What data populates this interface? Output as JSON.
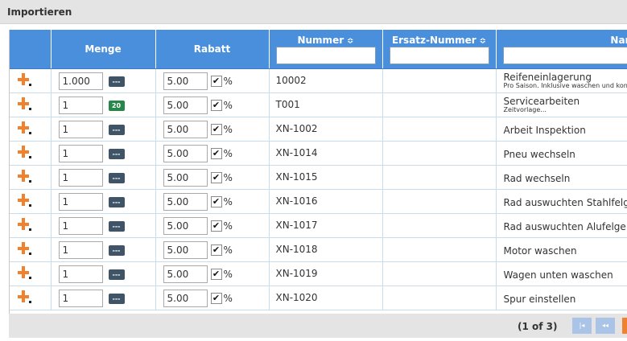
{
  "panel": {
    "title": "Importieren"
  },
  "columns": {
    "menge": "Menge",
    "rabatt": "Rabatt",
    "nummer": "Nummer",
    "ersatz": "Ersatz-Nummer",
    "name": "Name",
    "sort_glyph": "≎"
  },
  "icons": {
    "add": "add-plus-icon",
    "sort": "sort-icon",
    "check": "✔",
    "percent": "%"
  },
  "colors": {
    "header": "#4a8fdc",
    "accent": "#f0822d",
    "unit_button": "#405468",
    "badge_green": "#27874a"
  },
  "rows": [
    {
      "menge": "1.000",
      "unit": "---",
      "rabatt": "5.00",
      "nummer": "10002",
      "name": "Reifeneinlagerung",
      "desc": "Pro Saison. Inklusive waschen und kontr"
    },
    {
      "menge": "1",
      "unit": "20",
      "rabatt": "5.00",
      "nummer": "T001",
      "name": "Servicearbeiten",
      "desc": "Zeitvorlage..."
    },
    {
      "menge": "1",
      "unit": "---",
      "rabatt": "5.00",
      "nummer": "XN-1002",
      "name": "Arbeit Inspektion",
      "desc": ""
    },
    {
      "menge": "1",
      "unit": "---",
      "rabatt": "5.00",
      "nummer": "XN-1014",
      "name": "Pneu wechseln",
      "desc": ""
    },
    {
      "menge": "1",
      "unit": "---",
      "rabatt": "5.00",
      "nummer": "XN-1015",
      "name": "Rad wechseln",
      "desc": ""
    },
    {
      "menge": "1",
      "unit": "---",
      "rabatt": "5.00",
      "nummer": "XN-1016",
      "name": "Rad auswuchten Stahlfelge",
      "desc": ""
    },
    {
      "menge": "1",
      "unit": "---",
      "rabatt": "5.00",
      "nummer": "XN-1017",
      "name": "Rad auswuchten Alufelge",
      "desc": ""
    },
    {
      "menge": "1",
      "unit": "---",
      "rabatt": "5.00",
      "nummer": "XN-1018",
      "name": "Motor waschen",
      "desc": ""
    },
    {
      "menge": "1",
      "unit": "---",
      "rabatt": "5.00",
      "nummer": "XN-1019",
      "name": "Wagen unten waschen",
      "desc": ""
    },
    {
      "menge": "1",
      "unit": "---",
      "rabatt": "5.00",
      "nummer": "XN-1020",
      "name": "Spur einstellen",
      "desc": ""
    }
  ],
  "pager": {
    "info": "(1 of 3)",
    "first": "|◂",
    "prev": "◂◂"
  }
}
